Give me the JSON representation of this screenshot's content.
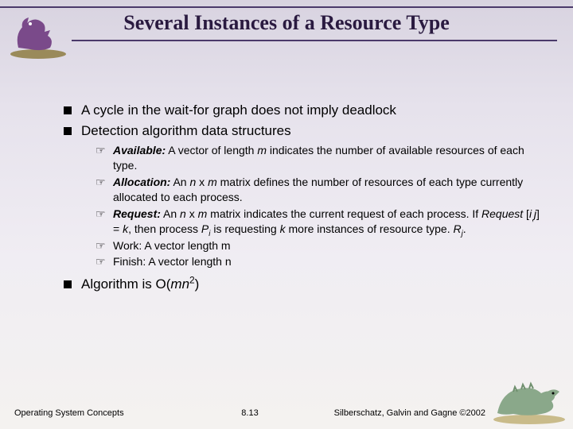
{
  "title": "Several Instances of a Resource Type",
  "bullets": {
    "b1": "A cycle in the wait-for graph does not imply deadlock",
    "b2": "Detection algorithm data structures",
    "sub": {
      "s1_label": "Available:",
      "s1_rest": "  A vector of length ",
      "s1_m": "m",
      "s1_tail": " indicates the number of available resources of each type.",
      "s2_label": "Allocation:",
      "s2_a": "  An ",
      "s2_n": "n",
      "s2_x": " x ",
      "s2_m": "m",
      "s2_tail": " matrix defines the number of resources of each type currently allocated to each process.",
      "s3_label": "Request:",
      "s3_a": "  An ",
      "s3_n": "n",
      "s3_x": " x ",
      "s3_m": "m",
      "s3_b": " matrix indicates the current request  of each process.  If ",
      "s3_req": "Request",
      "s3_c": " [",
      "s3_i": "i",
      "s3_comma": ",",
      "s3_j1": "j",
      "s3_d": "] = ",
      "s3_k": "k",
      "s3_e": ", then process ",
      "s3_P": "P",
      "s3_isub": "i",
      "s3_f": " is requesting ",
      "s3_k2": "k",
      "s3_g": " more instances of resource type. ",
      "s3_R": "R",
      "s3_jsub": "j",
      "s3_dot": ".",
      "s4": "Work: A vector length m",
      "s5": "Finish: A vector length n"
    },
    "b3_a": "Algorithm is O(",
    "b3_mn": "mn",
    "b3_exp": "2",
    "b3_b": ")"
  },
  "footer": {
    "left": "Operating System Concepts",
    "center": "8.13",
    "right": "Silberschatz, Galvin and  Gagne ©2002"
  }
}
